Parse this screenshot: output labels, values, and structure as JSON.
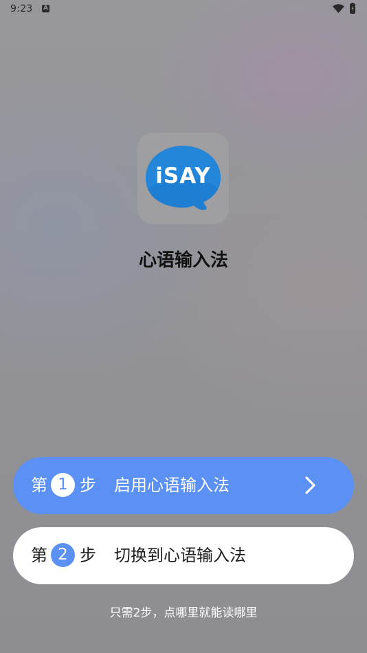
{
  "status_bar": {
    "time": "9:23",
    "notification_icon": "a-letter-icon",
    "icons": [
      "wifi-icon",
      "battery-charging-icon"
    ]
  },
  "app": {
    "logo_text": "iSAY",
    "name": "心语输入法",
    "colors": {
      "logo_blue": "#1e7ed2",
      "accent": "#5b90f4"
    }
  },
  "steps": [
    {
      "prefix": "第",
      "number": "1",
      "suffix": "步",
      "label": "启用心语输入法"
    },
    {
      "prefix": "第",
      "number": "2",
      "suffix": "步",
      "label": "切换到心语输入法"
    }
  ],
  "footer": {
    "text": "只需2步，点哪里就能读哪里"
  }
}
